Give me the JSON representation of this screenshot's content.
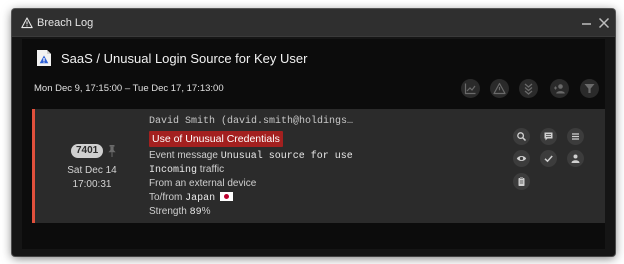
{
  "window": {
    "title": "Breach Log",
    "icons": {
      "title": "warning-triangle-icon",
      "minimize": "minimize-icon",
      "close": "close-icon"
    }
  },
  "header": {
    "title": "SaaS / Unusual Login Source for Key User",
    "icon": "alert-document-icon",
    "date_range": "Mon Dec 9, 17:15:00 – Tue Dec 17, 17:13:00"
  },
  "toolbar": {
    "buttons": [
      {
        "name": "chart-icon"
      },
      {
        "name": "warning-icon"
      },
      {
        "name": "collapse-icon"
      },
      {
        "name": "user-group-icon"
      },
      {
        "name": "filter-icon"
      }
    ]
  },
  "entry": {
    "accent_color": "#e0503c",
    "count": "7401",
    "date": "Sat Dec 14",
    "time": "17:00:31",
    "user": "David Smith (david.smith@holdings…",
    "alert_type": "Use of Unusual Credentials",
    "event_prefix": "Event message",
    "event_value": "Unusual source for use",
    "incoming_value": "Incoming",
    "incoming_suffix": "traffic",
    "origin": "From an external device",
    "location_prefix": "To/from",
    "location_value": "Japan",
    "strength_prefix": "Strength",
    "strength_value": "89",
    "strength_unit": "%",
    "actions": [
      "search-icon",
      "comment-icon",
      "menu-icon",
      "view-icon",
      "check-icon",
      "user-icon",
      "clipboard-icon"
    ]
  },
  "colors": {
    "alert_chip": "#a3201f",
    "panel_bg": "#0c0c0c",
    "entry_bg": "#2b2b2b"
  }
}
